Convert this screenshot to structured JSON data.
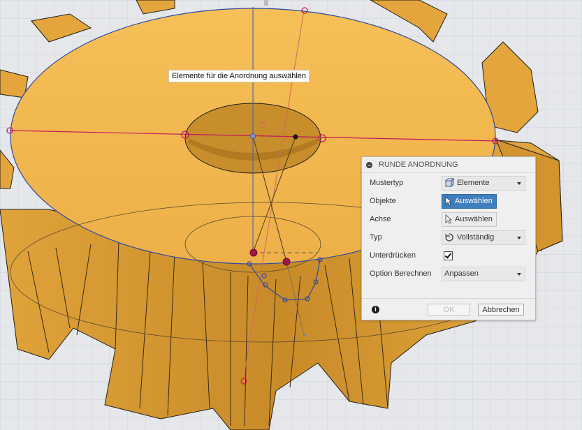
{
  "tooltip": "Elemente für die Anordnung auswählen",
  "dialog": {
    "title": "RUNDE ANORDNUNG",
    "rows": [
      {
        "label": "Mustertyp",
        "value": "Elemente",
        "icon": "body-icon"
      },
      {
        "label": "Objekte",
        "value": "Auswählen",
        "icon": "cursor-arrow-icon"
      },
      {
        "label": "Achse",
        "value": "Auswählen",
        "icon": "cursor-arrow-icon"
      },
      {
        "label": "Typ",
        "value": "Vollständig",
        "icon": "circular-arrow-icon"
      },
      {
        "label": "Unterdrücken",
        "checked": true
      },
      {
        "label": "Option Berechnen",
        "value": "Anpassen"
      }
    ],
    "ok_label": "OK",
    "cancel_label": "Abbrechen",
    "info_glyph": "i"
  },
  "colors": {
    "background": "#e6e7ea",
    "gear_face": "#f2b64a",
    "gear_side": "#d99a30",
    "sketch_blue": "#2b4aa3",
    "sketch_red": "#c2185b",
    "accent": "#3f7fbd"
  }
}
